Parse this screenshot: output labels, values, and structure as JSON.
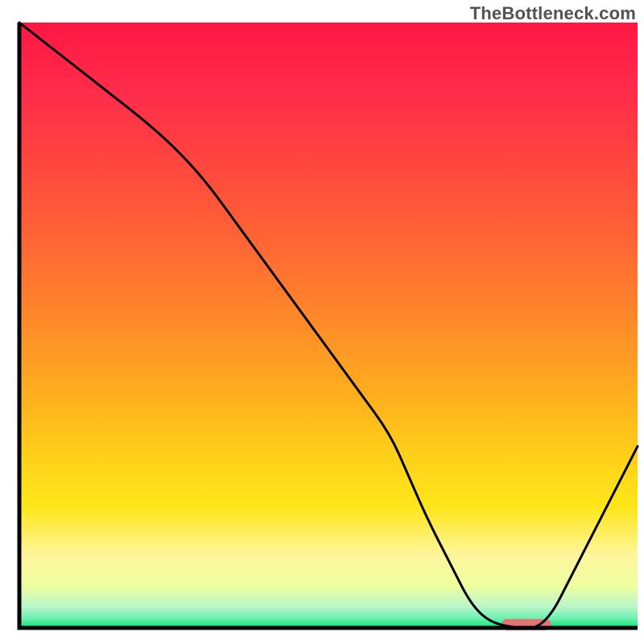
{
  "watermark": "TheBottleneck.com",
  "chart_data": {
    "type": "line",
    "title": "",
    "xlabel": "",
    "ylabel": "",
    "xlim": [
      0,
      100
    ],
    "ylim": [
      0,
      100
    ],
    "x": [
      0,
      5,
      10,
      15,
      20,
      25,
      30,
      35,
      40,
      45,
      50,
      55,
      60,
      63,
      66,
      70,
      73,
      76,
      80,
      85,
      90,
      95,
      100
    ],
    "values": [
      100,
      96,
      92,
      88,
      84,
      79.5,
      74,
      67,
      60,
      53,
      46,
      39,
      32,
      25,
      18,
      10,
      4,
      1,
      0,
      0,
      10,
      20,
      30
    ],
    "background_gradient": {
      "stops": [
        {
          "offset": 0.0,
          "color": "#ff1744"
        },
        {
          "offset": 0.12,
          "color": "#ff2d4a"
        },
        {
          "offset": 0.25,
          "color": "#ff4a3d"
        },
        {
          "offset": 0.38,
          "color": "#ff6a33"
        },
        {
          "offset": 0.5,
          "color": "#ff8c28"
        },
        {
          "offset": 0.62,
          "color": "#ffb01e"
        },
        {
          "offset": 0.72,
          "color": "#ffd119"
        },
        {
          "offset": 0.8,
          "color": "#ffe61a"
        },
        {
          "offset": 0.88,
          "color": "#fff59d"
        },
        {
          "offset": 0.93,
          "color": "#eeff9e"
        },
        {
          "offset": 0.965,
          "color": "#b9f6ca"
        },
        {
          "offset": 0.985,
          "color": "#69f0ae"
        },
        {
          "offset": 1.0,
          "color": "#00e676"
        }
      ]
    },
    "marker": {
      "x_start": 78,
      "x_end": 86,
      "y": 0,
      "color": "#e57373"
    },
    "curve_color": "#000000",
    "axis_color": "#000000"
  }
}
